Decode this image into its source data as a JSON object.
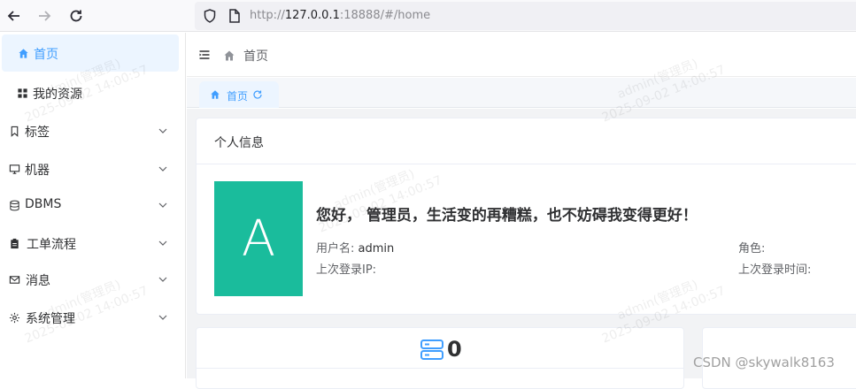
{
  "browser": {
    "url_prefix": "http://",
    "url_host": "127.0.0.1",
    "url_rest": ":18888/#/home"
  },
  "sidebar": {
    "items": [
      {
        "label": "首页",
        "icon": "home-icon",
        "active": true,
        "expandable": false
      },
      {
        "label": "我的资源",
        "icon": "grid-icon",
        "active": false,
        "expandable": false
      },
      {
        "label": "标签",
        "icon": "bookmark-icon",
        "active": false,
        "expandable": true
      },
      {
        "label": "机器",
        "icon": "monitor-icon",
        "active": false,
        "expandable": true
      },
      {
        "label": "DBMS",
        "icon": "database-icon",
        "active": false,
        "expandable": true
      },
      {
        "label": "工单流程",
        "icon": "clipboard-icon",
        "active": false,
        "expandable": true
      },
      {
        "label": "消息",
        "icon": "mail-icon",
        "active": false,
        "expandable": true
      },
      {
        "label": "系统管理",
        "icon": "gear-icon",
        "active": false,
        "expandable": true
      }
    ]
  },
  "header": {
    "breadcrumb": "首页"
  },
  "tags": [
    {
      "label": "首页"
    }
  ],
  "profile_card": {
    "title": "个人信息",
    "avatar_letter": "A",
    "greeting": "您好， 管理员，生活变的再糟糕，也不妨碍我变得更好！",
    "username_label": "用户名:",
    "username_value": "admin",
    "role_label": "角色:",
    "last_ip_label": "上次登录IP:",
    "last_time_label": "上次登录时间:"
  },
  "stats": {
    "count": "0"
  },
  "watermark": {
    "line1": "admin(管理员)",
    "line2": "2025-09-02 14:00:57"
  },
  "footer_mark": "CSDN @skywalk8163",
  "colors": {
    "primary": "#409eff",
    "avatar_bg": "#1abc9c"
  }
}
